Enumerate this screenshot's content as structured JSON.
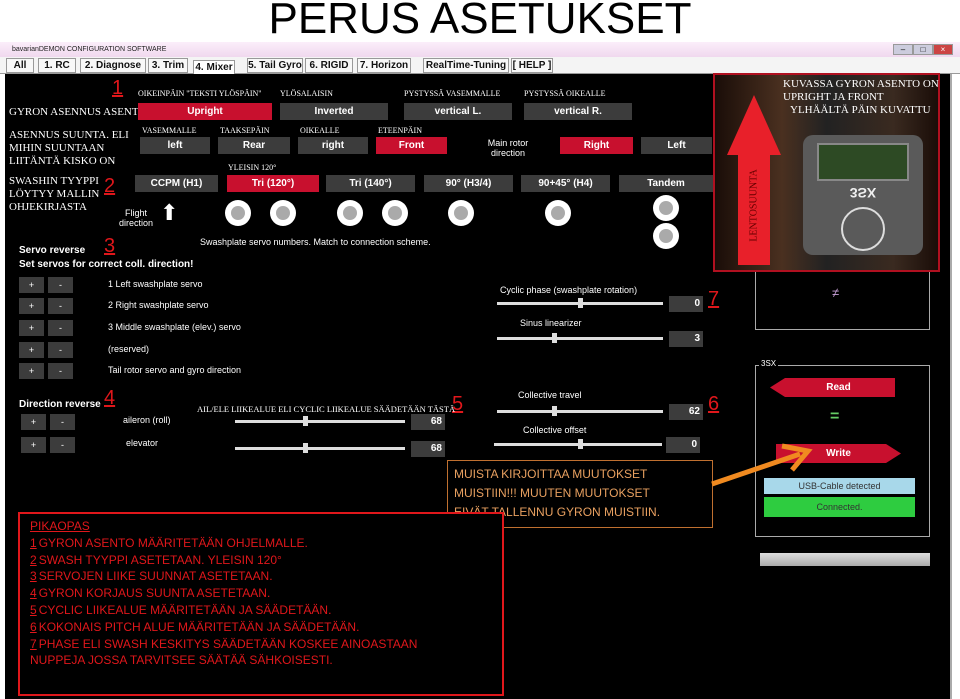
{
  "page_title": "PERUS ASETUKSET",
  "window_title": "bavarianDEMON CONFIGURATION SOFTWARE",
  "tabs": [
    "All",
    "1. RC",
    "2. Diagnose",
    "3. Trim",
    "4. Mixer",
    "5. Tail Gyro",
    "6. RIGID",
    "7. Horizon",
    "RealTime-Tuning",
    "[ HELP ]"
  ],
  "active_tab": "4. Mixer",
  "accent": "#c8102e",
  "markers": [
    "1",
    "2",
    "3",
    "4",
    "5",
    "6",
    "7"
  ],
  "mount": {
    "label": "GYRON ASENNUS ASENTO",
    "options": [
      {
        "caption": "OIKEINPÄIN \"TEKSTI YLÖSPÄIN\"",
        "label": "Upright",
        "on": true
      },
      {
        "caption": "YLÖSALAISIN",
        "label": "Inverted"
      },
      {
        "caption": "PYSTYSSÄ VASEMMALLE",
        "label": "vertical L."
      },
      {
        "caption": "PYSTYSSÄ OIKEALLE",
        "label": "vertical R."
      }
    ]
  },
  "direction": {
    "label": [
      "ASENNUS SUUNTA. ELI",
      "MIHIN SUUNTAAN",
      "LIITÄNTÄ KISKO ON"
    ],
    "options": [
      {
        "caption": "VASEMMALLE",
        "label": "left"
      },
      {
        "caption": "TAAKSEPÄIN",
        "label": "Rear"
      },
      {
        "caption": "OIKEALLE",
        "label": "right"
      },
      {
        "caption": "ETEENPÄIN",
        "label": "Front",
        "on": true
      }
    ],
    "rotor_label": "Main rotor direction",
    "rotor": [
      {
        "label": "Right",
        "on": true
      },
      {
        "label": "Left"
      }
    ]
  },
  "swash": {
    "label": [
      "SWASHIN TYYPPI",
      "LÖYTYY MALLIN",
      "OHJEKIRJASTA"
    ],
    "caption": "YLEISIN 120°",
    "options": [
      {
        "label": "CCPM  (H1)"
      },
      {
        "label": "Tri (120°)",
        "on": true
      },
      {
        "label": "Tri (140°)"
      },
      {
        "label": "90° (H3/4)"
      },
      {
        "label": "90+45° (H4)"
      },
      {
        "label": "Tandem"
      }
    ],
    "flight_direction": "Flight direction",
    "note": "Swashplate servo numbers. Match to connection scheme."
  },
  "servo_reverse": {
    "title": "Servo reverse",
    "subtitle": "Set servos for correct coll. direction!",
    "rows": [
      {
        "label": "1  Left swashplate servo",
        "plus": true
      },
      {
        "label": "2  Right swashplate servo",
        "plus": false
      },
      {
        "label": "3  Middle swashplate (elev.) servo",
        "plus": false
      },
      {
        "label": "(reserved)",
        "plus": true
      },
      {
        "label": "Tail rotor servo and gyro direction",
        "plus": true
      }
    ]
  },
  "direction_reverse": {
    "title": "Direction reverse",
    "rows": [
      {
        "label": "aileron (roll)",
        "plus": true
      },
      {
        "label": "elevator",
        "plus": true
      }
    ]
  },
  "cyclic": {
    "caption": "AIL/ELE LIIKEALUE ELI CYCLIC LIIKEALUE SÄÄDETÄÄN TÄSTÄ",
    "aileron": "68",
    "elevator": "68"
  },
  "sliders": [
    {
      "label": "Cyclic phase (swashplate rotation)",
      "value": "0"
    },
    {
      "label": "Sinus linearizer",
      "value": "3"
    },
    {
      "label": "Collective travel",
      "value": "62"
    },
    {
      "label": "Collective offset",
      "value": "0"
    }
  ],
  "photo": {
    "caption": [
      "KUVASSA GYRON ASENTO ON",
      "UPRIGHT JA FRONT",
      "YLHÄÄLTÄ PÄIN KUVATTU"
    ],
    "arrow_label": "LENTOSUUNTA",
    "device": "3SX"
  },
  "compare_top": "≠",
  "group": {
    "title": "3SX",
    "read": "Read",
    "equal": "=",
    "write": "Write",
    "usb": "USB-Cable detected",
    "connected": "Connected."
  },
  "note": [
    "MUISTA KIRJOITTAA MUUTOKSET",
    "MUISTIIN!!! MUUTEN MUUTOKSET",
    "EIVÄT TALLENNU GYRON MUISTIIN."
  ],
  "guide": {
    "title": "PIKAOPAS",
    "items": [
      {
        "n": "1",
        "t": "GYRON ASENTO MÄÄRITETÄÄN OHJELMALLE."
      },
      {
        "n": "2",
        "t": "SWASH TYYPPI ASETETAAN. YLEISIN 120°"
      },
      {
        "n": "3",
        "t": "SERVOJEN LIIKE SUUNNAT ASETETAAN."
      },
      {
        "n": "4",
        "t": "GYRON KORJAUS SUUNTA ASETETAAN."
      },
      {
        "n": "5",
        "t": "CYCLIC LIIKEALUE MÄÄRITETÄÄN JA SÄÄDETÄÄN."
      },
      {
        "n": "6",
        "t": "KOKONAIS PITCH ALUE MÄÄRITETÄÄN JA SÄÄDETÄÄN."
      },
      {
        "n": "7",
        "t": "PHASE ELI SWASH KESKITYS SÄÄDETÄÄN KOSKEE AINOASTAAN"
      }
    ],
    "last": "NUPPEJA JOSSA TARVITSEE  SÄÄTÄÄ SÄHKOISESTI."
  }
}
